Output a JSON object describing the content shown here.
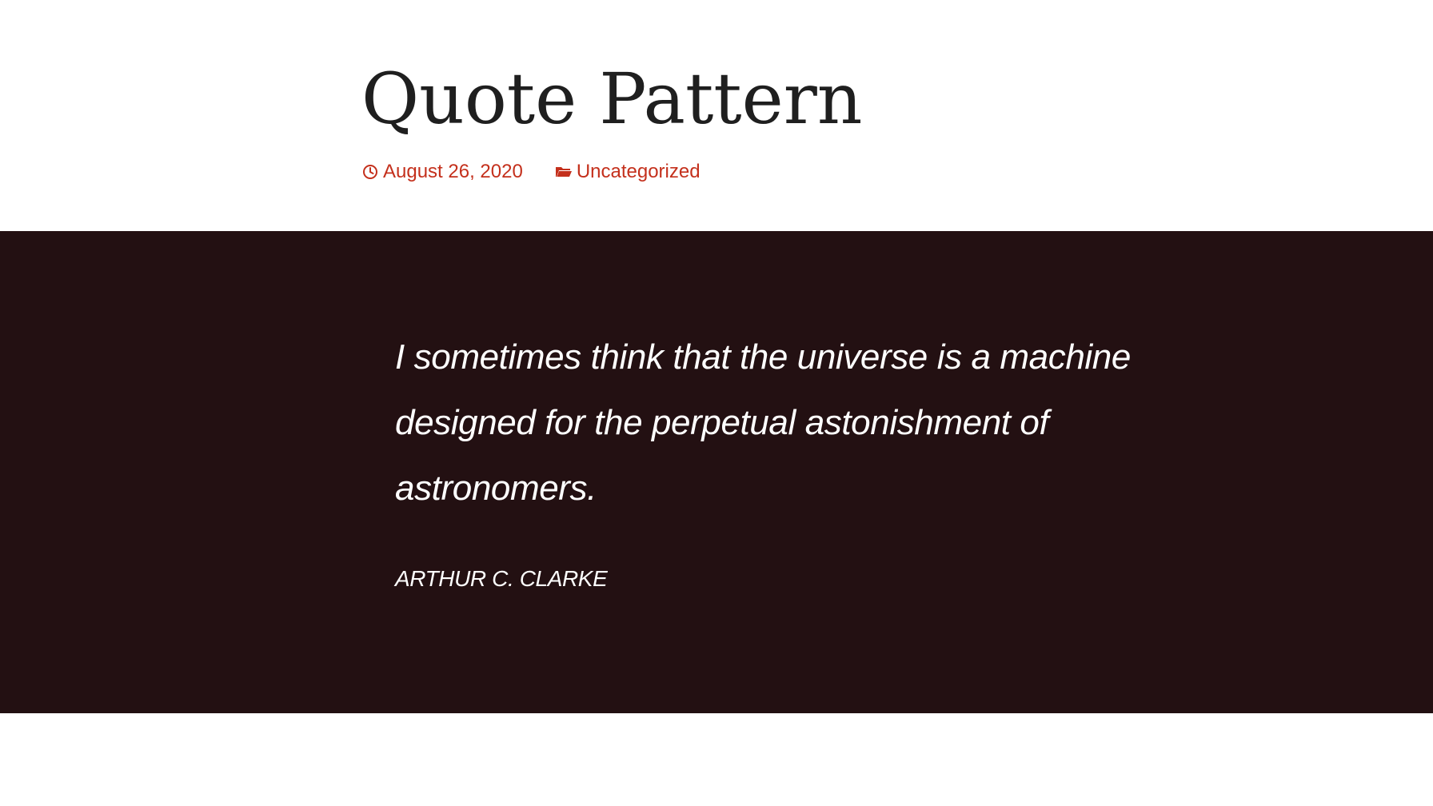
{
  "post": {
    "title": "Quote Pattern",
    "meta": {
      "date": "August 26, 2020",
      "category": "Uncategorized",
      "date_icon": "clock-icon",
      "category_icon": "folder-icon",
      "accent_color": "#c4301c"
    }
  },
  "quote": {
    "text": "I sometimes think that the universe is a machine designed for the perpetual astonishment of astronomers.",
    "citation": "ARTHUR C. CLARKE",
    "background_color": "#231012",
    "text_color": "#ffffff"
  }
}
